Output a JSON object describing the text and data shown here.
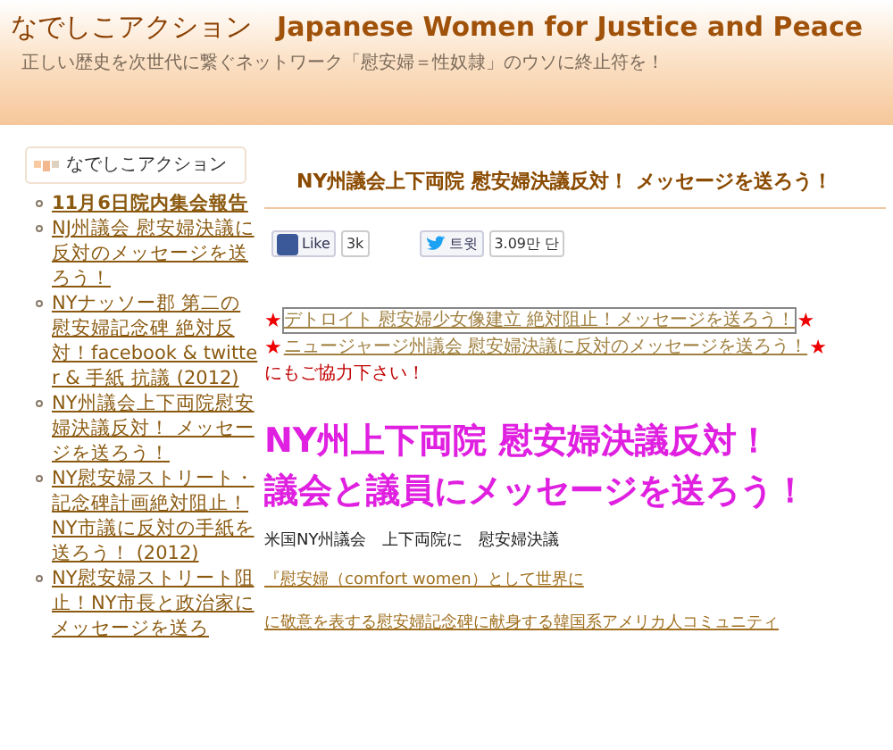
{
  "site": {
    "title_ja": "なでしこアクション",
    "title_en": "Japanese Women for Justice and Peace",
    "tagline": "正しい歴史を次世代に繋ぐネットワーク「慰安婦＝性奴隷」のウソに終止符を！"
  },
  "sidebar": {
    "heading": "なでしこアクション",
    "items": [
      {
        "label": "11月6日院内集会報告",
        "bold": true
      },
      {
        "label": "NJ州議会 慰安婦決議に反対のメッセージを送ろう！",
        "bold": false
      },
      {
        "label": "NYナッソー郡 第二の慰安婦記念碑 絶対反対！facebook & twitter & 手紙 抗議 (2012)",
        "bold": false
      },
      {
        "label": "NY州議会上下両院慰安婦決議反対！ メッセージを送ろう！",
        "bold": false
      },
      {
        "label": "NY慰安婦ストリート・記念碑計画絶対阻止！NY市議に反対の手紙を送ろう！ (2012)",
        "bold": false
      },
      {
        "label": "NY慰安婦ストリート阻止！NY市長と政治家にメッセージを送ろ",
        "bold": false
      }
    ]
  },
  "post": {
    "title": "NY州議会上下両院 慰安婦決議反対！ メッセージを送ろう！",
    "share": [
      {
        "kind": "facebook",
        "label": "Like",
        "count": "3k"
      },
      {
        "kind": "twitter",
        "label": "트윗",
        "count": "3.09만 단"
      }
    ],
    "links": [
      {
        "mark": "★",
        "label": "デトロイト 慰安婦少女像建立 絶対阻止！メッセージを送ろう！",
        "end": "★",
        "focused": true
      },
      {
        "mark": "★",
        "label": "ニュージャージ州議会 慰安婦決議に反対のメッセージを送ろう！",
        "end": "★",
        "focused": false
      }
    ],
    "note": "にもご協力下さい！",
    "headline": [
      "NY州上下両院 慰安婦決議反対！",
      "議会と議員にメッセージを送ろう！"
    ],
    "body": [
      {
        "kind": "text",
        "text": "米国NY州議会　上下両院に　慰安婦決議"
      },
      {
        "kind": "link",
        "text": "『慰安婦（comfort women）として世界に"
      },
      {
        "kind": "link",
        "text": "に敬意を表する慰安婦記念碑に献身する韓国系アメリカ人コミュニティ"
      }
    ]
  }
}
